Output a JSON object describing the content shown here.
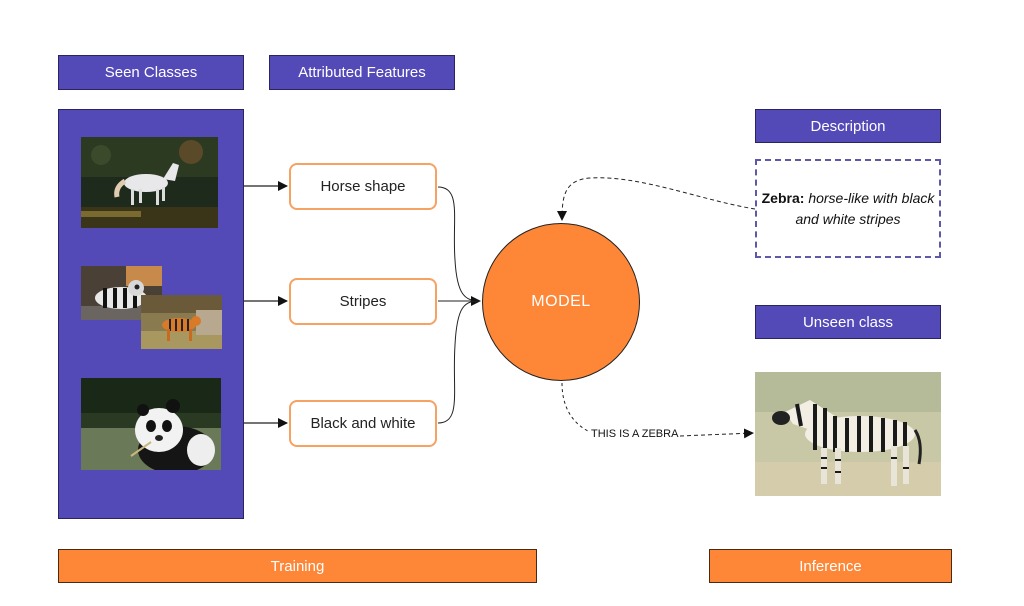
{
  "headers": {
    "seen_classes": "Seen Classes",
    "attributed_features": "Attributed Features",
    "description": "Description",
    "unseen_class": "Unseen class"
  },
  "seen_class_images": [
    {
      "subject": "white horse running"
    },
    {
      "subject": "ring-tailed lemur"
    },
    {
      "subject": "tiger"
    },
    {
      "subject": "giant panda"
    }
  ],
  "features": [
    {
      "label": "Horse shape"
    },
    {
      "label": "Stripes"
    },
    {
      "label": "Black and white"
    }
  ],
  "model": {
    "label": "MODEL"
  },
  "description": {
    "name": "Zebra:",
    "text": "horse-like with black and white stripes"
  },
  "unseen_image": {
    "subject": "zebra"
  },
  "output_label": "THIS IS A ZEBRA",
  "phases": {
    "training": "Training",
    "inference": "Inference"
  },
  "colors": {
    "purple": "#5349b7",
    "orange": "#fd8637",
    "feature_border": "#f5a263"
  }
}
